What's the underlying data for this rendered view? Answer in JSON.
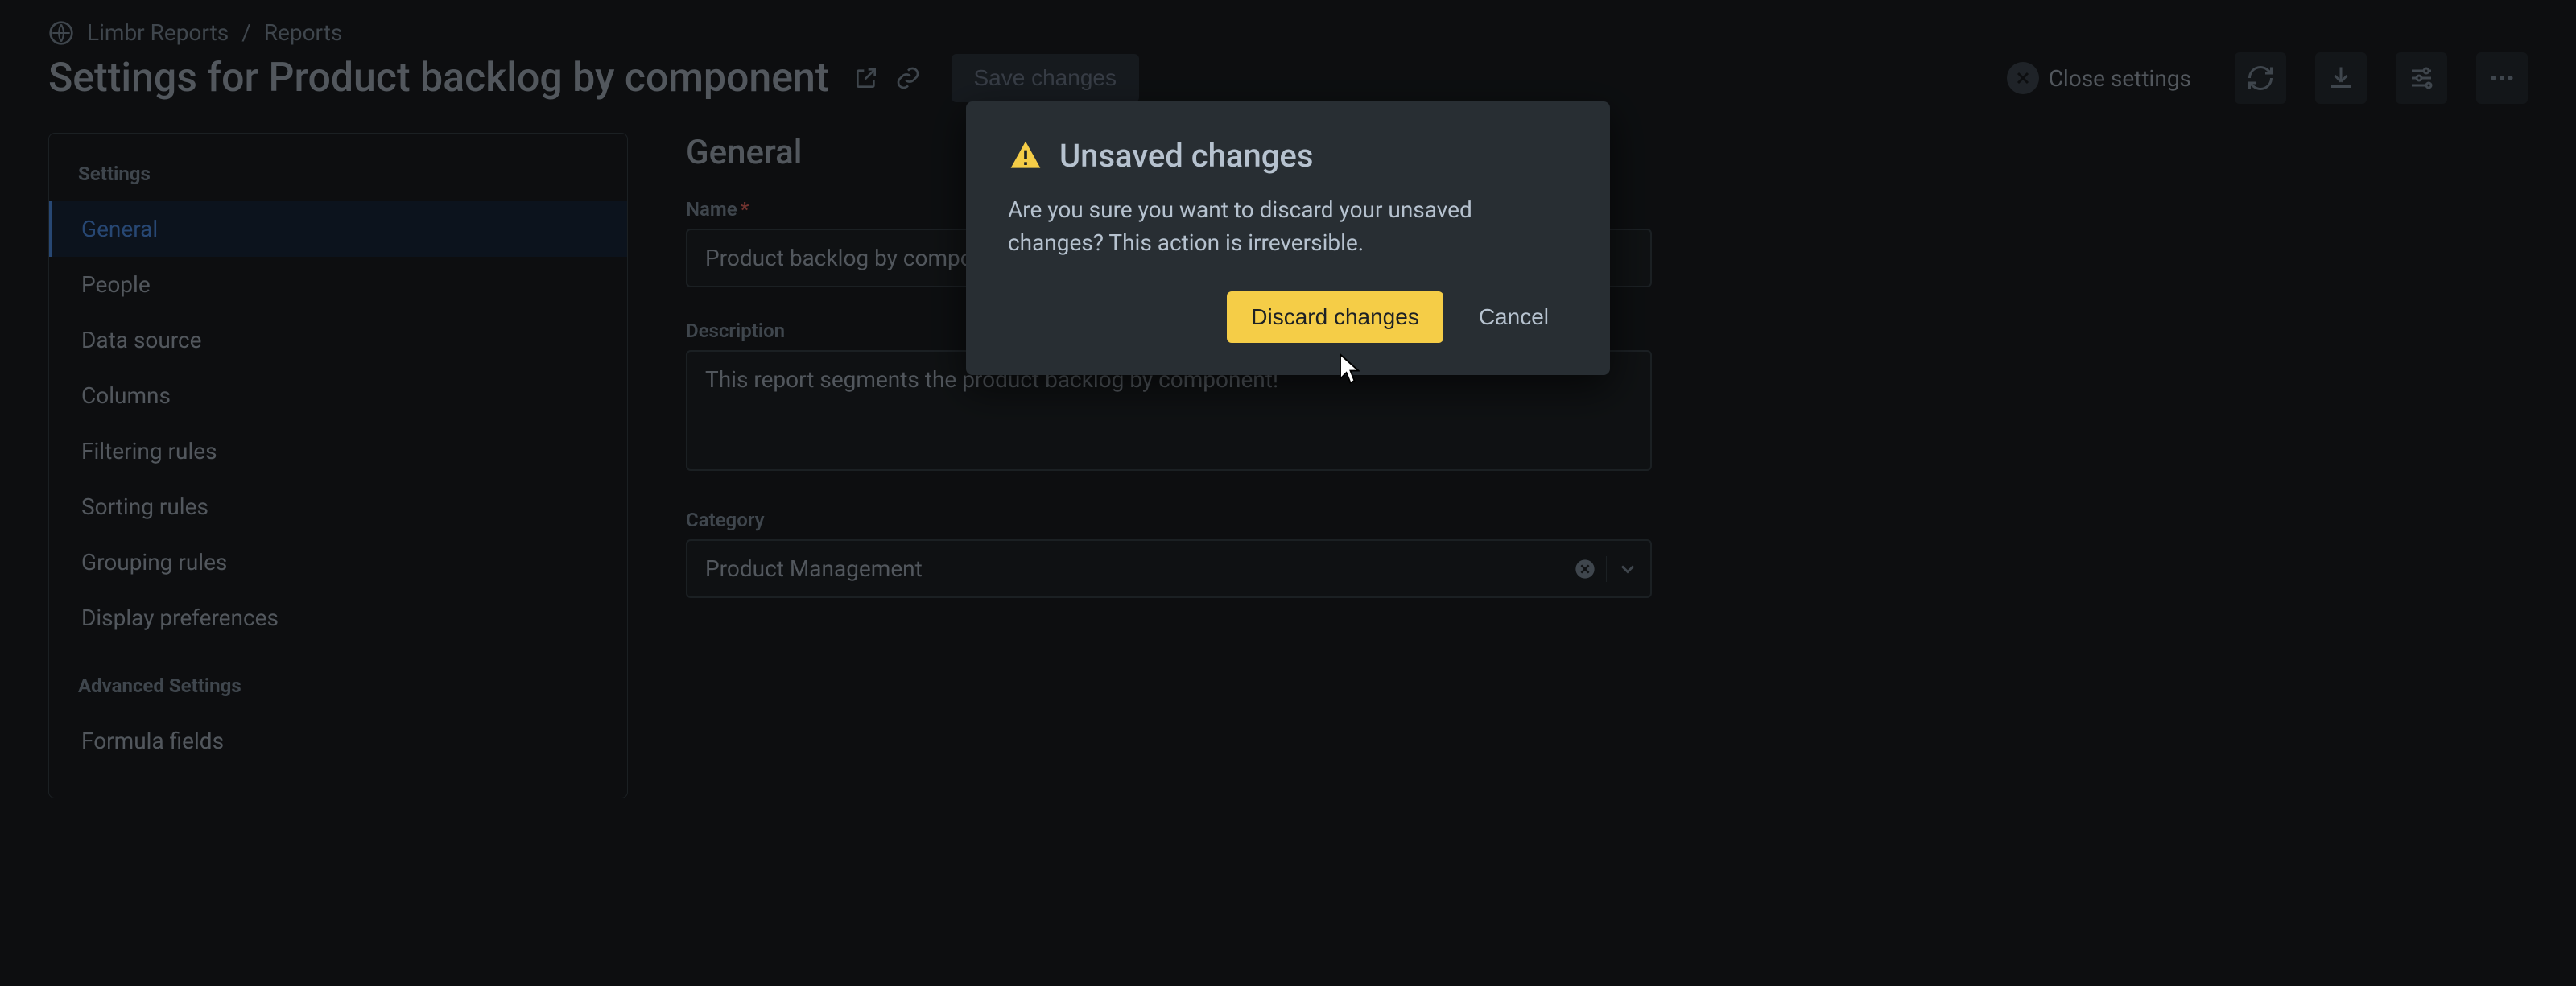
{
  "breadcrumb": {
    "app_name": "Limbr Reports",
    "separator": "/",
    "section": "Reports"
  },
  "header": {
    "page_title": "Settings for Product backlog by component",
    "save_label": "Save changes",
    "close_label": "Close settings"
  },
  "sidebar": {
    "group1_title": "Settings",
    "group2_title": "Advanced Settings",
    "items": [
      {
        "label": "General",
        "selected": true
      },
      {
        "label": "People",
        "selected": false
      },
      {
        "label": "Data source",
        "selected": false
      },
      {
        "label": "Columns",
        "selected": false
      },
      {
        "label": "Filtering rules",
        "selected": false
      },
      {
        "label": "Sorting rules",
        "selected": false
      },
      {
        "label": "Grouping rules",
        "selected": false
      },
      {
        "label": "Display preferences",
        "selected": false
      }
    ],
    "advanced_items": [
      {
        "label": "Formula fields",
        "selected": false
      }
    ]
  },
  "form": {
    "section_heading": "General",
    "name_label": "Name",
    "required_mark": "*",
    "name_value": "Product backlog by component",
    "description_label": "Description",
    "description_value": "This report segments the product backlog by component!",
    "category_label": "Category",
    "category_value": "Product Management"
  },
  "modal": {
    "title": "Unsaved changes",
    "body": "Are you sure you want to discard your unsaved changes? This action is irreversible.",
    "discard_label": "Discard changes",
    "cancel_label": "Cancel"
  }
}
